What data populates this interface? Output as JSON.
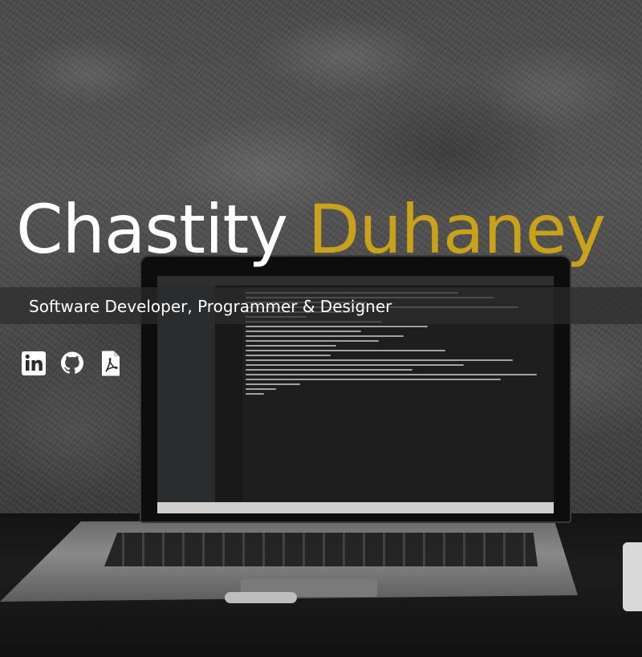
{
  "hero": {
    "first_name": "Chastity",
    "last_name": "Duhaney",
    "tagline": "Software Developer, Programmer & Designer"
  },
  "social_links": [
    {
      "icon": "linkedin-icon"
    },
    {
      "icon": "github-icon"
    },
    {
      "icon": "pdf-icon"
    }
  ],
  "colors": {
    "accent": "#c9a21a",
    "text": "#ffffff",
    "band": "#2d2d2d"
  }
}
